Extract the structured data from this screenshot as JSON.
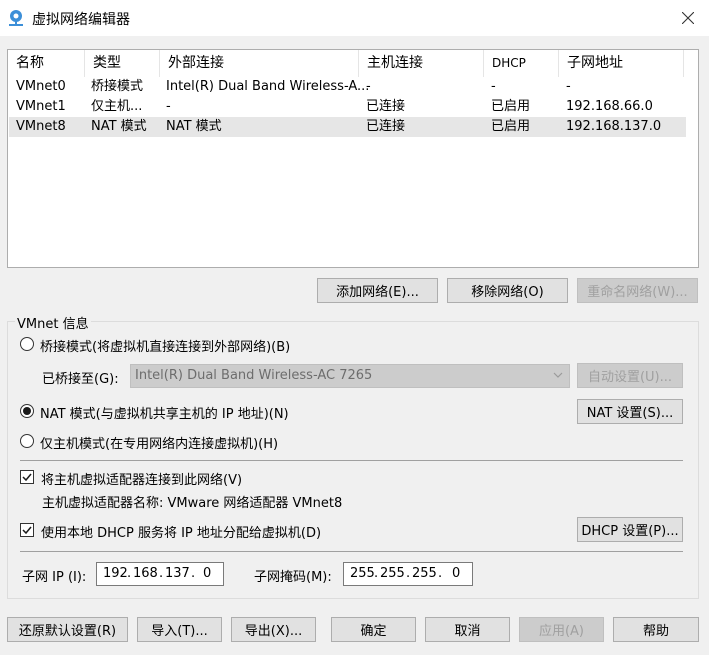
{
  "window": {
    "title": "虚拟网络编辑器",
    "icon": "virtual-network-icon",
    "close_icon": "close-icon"
  },
  "table": {
    "columns": [
      "名称",
      "类型",
      "外部连接",
      "主机连接",
      "DHCP",
      "子网地址"
    ],
    "rows": [
      {
        "name": "VMnet0",
        "type": "桥接模式",
        "external": "Intel(R) Dual Band Wireless-A...",
        "host": "-",
        "dhcp": "-",
        "subnet": "-"
      },
      {
        "name": "VMnet1",
        "type": "仅主机...",
        "external": "-",
        "host": "已连接",
        "dhcp": "已启用",
        "subnet": "192.168.66.0"
      },
      {
        "name": "VMnet8",
        "type": "NAT 模式",
        "external": "NAT 模式",
        "host": "已连接",
        "dhcp": "已启用",
        "subnet": "192.168.137.0"
      }
    ],
    "selected_row": "VMnet8"
  },
  "list_buttons": {
    "add": "添加网络(E)...",
    "remove": "移除网络(O)",
    "rename": "重命名网络(W)..."
  },
  "vmnet_info": {
    "group_label": "VMnet 信息",
    "bridge_radio": "桥接模式(将虚拟机直接连接到外部网络)(B)",
    "bridged_to_label": "已桥接至(G):",
    "bridged_to_value": "Intel(R) Dual Band Wireless-AC 7265",
    "auto_settings": "自动设置(U)...",
    "nat_radio": "NAT 模式(与虚拟机共享主机的 IP 地址)(N)",
    "nat_settings": "NAT 设置(S)...",
    "hostonly_radio": "仅主机模式(在专用网络内连接虚拟机)(H)",
    "selected_mode": "nat",
    "connect_adapter_checkbox": "将主机虚拟适配器连接到此网络(V)",
    "connect_adapter_checked": true,
    "adapter_name_text": "主机虚拟适配器名称: VMware 网络适配器 VMnet8",
    "dhcp_checkbox": "使用本地 DHCP 服务将 IP 地址分配给虚拟机(D)",
    "dhcp_checked": true,
    "dhcp_settings": "DHCP 设置(P)...",
    "subnet_ip_label": "子网 IP (I):",
    "subnet_ip": [
      "192",
      "168",
      "137",
      "0"
    ],
    "subnet_mask_label": "子网掩码(M):",
    "subnet_mask": [
      "255",
      "255",
      "255",
      "0"
    ]
  },
  "footer": {
    "restore": "还原默认设置(R)",
    "import": "导入(T)...",
    "export": "导出(X)...",
    "ok": "确定",
    "cancel": "取消",
    "apply": "应用(A)",
    "help": "帮助"
  }
}
